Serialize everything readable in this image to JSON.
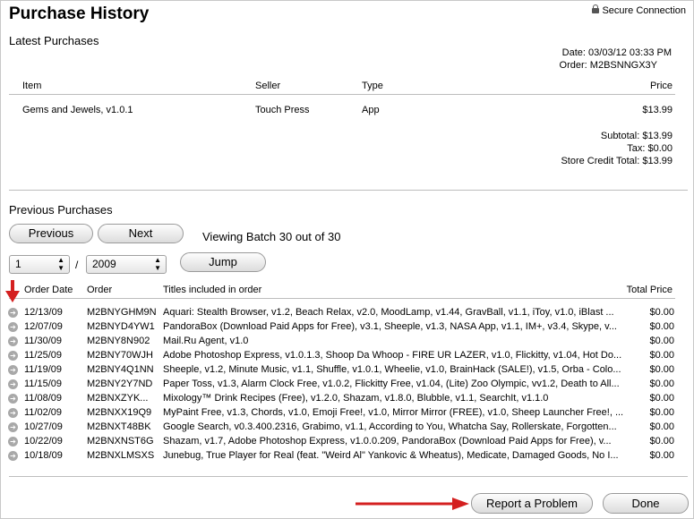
{
  "title": "Purchase History",
  "secure": "Secure Connection",
  "latest": {
    "heading": "Latest Purchases",
    "date_label": "Date:",
    "date": "03/03/12 03:33 PM",
    "order_label": "Order:",
    "order": "M2BSNNGX3Y",
    "columns": {
      "item": "Item",
      "seller": "Seller",
      "type": "Type",
      "price": "Price"
    },
    "item": {
      "name": "Gems and Jewels, v1.0.1",
      "seller": "Touch Press",
      "type": "App",
      "price": "$13.99"
    },
    "subtotal_label": "Subtotal:",
    "subtotal": "$13.99",
    "tax_label": "Tax:",
    "tax": "$0.00",
    "credit_label": "Store Credit Total:",
    "credit": "$13.99"
  },
  "previous": {
    "heading": "Previous Purchases",
    "prev_btn": "Previous",
    "next_btn": "Next",
    "batch": "Viewing Batch 30 out of 30",
    "batch_select": "1",
    "slash": "/",
    "year_select": "2009",
    "jump_btn": "Jump",
    "columns": {
      "date": "Order Date",
      "order": "Order",
      "titles": "Titles included in order",
      "total": "Total Price"
    },
    "rows": [
      {
        "date": "12/13/09",
        "order": "M2BNYGHM9N",
        "titles": "Aquari: Stealth Browser, v1.2, Beach Relax, v2.0, MoodLamp, v1.44, GravBall, v1.1, iToy, v1.0, iBlast ...",
        "total": "$0.00"
      },
      {
        "date": "12/07/09",
        "order": "M2BNYD4YW1",
        "titles": "PandoraBox (Download Paid Apps for Free), v3.1, Sheeple, v1.3, NASA App, v1.1, IM+, v3.4, Skype, v...",
        "total": "$0.00"
      },
      {
        "date": "11/30/09",
        "order": "M2BNY8N902",
        "titles": "Mail.Ru Agent, v1.0",
        "total": "$0.00"
      },
      {
        "date": "11/25/09",
        "order": "M2BNY70WJH",
        "titles": "Adobe Photoshop Express, v1.0.1.3, Shoop Da Whoop - FIRE UR LAZER, v1.0, Flickitty, v1.04, Hot Do...",
        "total": "$0.00"
      },
      {
        "date": "11/19/09",
        "order": "M2BNY4Q1NN",
        "titles": "Sheeple, v1.2, Minute Music, v1.1, Shuffle, v1.0.1, Wheelie, v1.0, BrainHack (SALE!), v1.5, Orba - Colo...",
        "total": "$0.00"
      },
      {
        "date": "11/15/09",
        "order": "M2BNY2Y7ND",
        "titles": "Paper Toss, v1.3, Alarm Clock Free, v1.0.2, Flickitty Free, v1.04, (Lite) Zoo Olympic, vv1.2, Death to All...",
        "total": "$0.00"
      },
      {
        "date": "11/08/09",
        "order": "M2BNXZYK...",
        "titles": "Mixology™ Drink Recipes (Free), v1.2.0, Shazam, v1.8.0, Blubble, v1.1, SearchIt, v1.1.0",
        "total": "$0.00"
      },
      {
        "date": "11/02/09",
        "order": "M2BNXX19Q9",
        "titles": "MyPaint Free, v1.3, Chords, v1.0, Emoji Free!, v1.0, Mirror Mirror (FREE), v1.0, Sheep Launcher Free!, ...",
        "total": "$0.00"
      },
      {
        "date": "10/27/09",
        "order": "M2BNXT48BK",
        "titles": "Google Search, v0.3.400.2316, Grabimo, v1.1, According to You, Whatcha Say, Rollerskate, Forgotten...",
        "total": "$0.00"
      },
      {
        "date": "10/22/09",
        "order": "M2BNXNST6G",
        "titles": "Shazam, v1.7, Adobe Photoshop Express, v1.0.0.209, PandoraBox (Download Paid Apps for Free), v...",
        "total": "$0.00"
      },
      {
        "date": "10/18/09",
        "order": "M2BNXLMSXS",
        "titles": "Junebug, True Player for Real (feat. \"Weird Al\" Yankovic & Wheatus), Medicate, Damaged Goods, No I...",
        "total": "$0.00"
      }
    ]
  },
  "footer": {
    "report_btn": "Report a Problem",
    "done_btn": "Done"
  },
  "colors": {
    "annotation": "#d42020",
    "separator": "#bdbdbd"
  }
}
